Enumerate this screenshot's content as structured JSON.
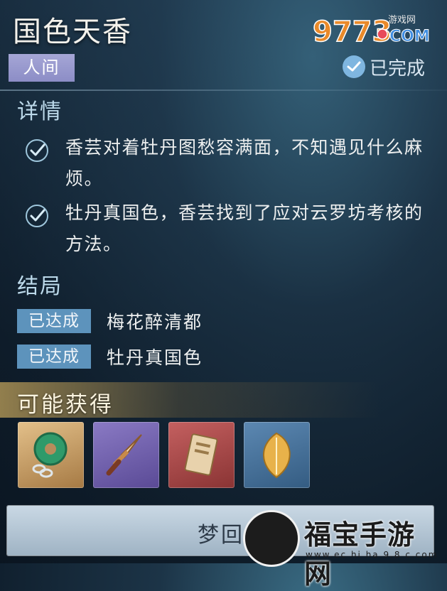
{
  "header": {
    "title": "国色天香",
    "realm_tag": "人间",
    "status_text": "已完成",
    "logo_text": "9773",
    "logo_sub": "游戏网",
    "logo_com": "COM"
  },
  "details": {
    "heading": "详情",
    "items": [
      {
        "text": "香芸对着牡丹图愁容满面，不知遇见什么麻烦。",
        "icon": "check-icon"
      },
      {
        "text": "牡丹真国色，香芸找到了应对云罗坊考核的方法。",
        "icon": "check-icon"
      }
    ]
  },
  "endings": {
    "heading": "结局",
    "items": [
      {
        "badge": "已达成",
        "name": "梅花醉清都"
      },
      {
        "badge": "已达成",
        "name": "牡丹真国色"
      }
    ]
  },
  "rewards": {
    "heading": "可能获得",
    "items": [
      {
        "name": "jade-pendant-icon",
        "rarity_color": "#c79a5c"
      },
      {
        "name": "dagger-icon",
        "rarity_color": "#6f5fb0"
      },
      {
        "name": "scroll-token-icon",
        "rarity_color": "#a84848"
      },
      {
        "name": "golden-leaf-icon",
        "rarity_color": "#4c78a2"
      }
    ]
  },
  "footer": {
    "button_label": "梦回",
    "watermark_big": "福宝手游网",
    "watermark_small": "www.ec hi ha 9.8 c.com"
  }
}
